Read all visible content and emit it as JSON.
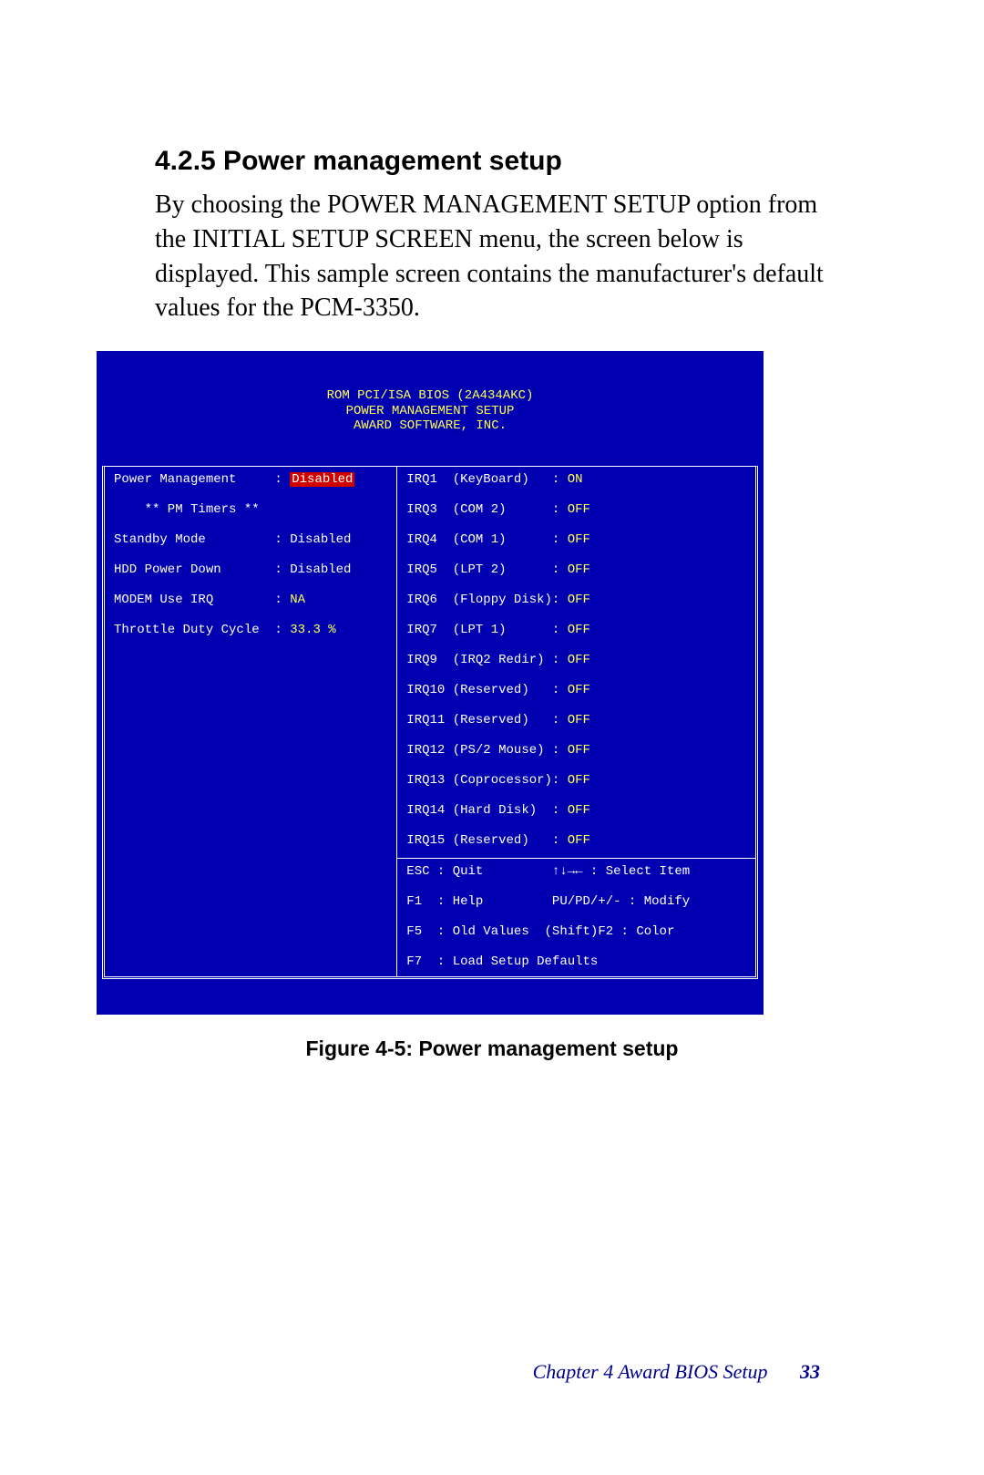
{
  "heading": "4.2.5 Power management setup",
  "body": "By choosing the POWER MANAGEMENT SETUP option from the INITIAL SETUP SCREEN menu, the screen below is displayed. This sample screen contains the manufacturer's default values for the PCM-3350.",
  "bios": {
    "header": {
      "l1": "ROM PCI/ISA BIOS (2A434AKC)",
      "l2": "POWER MANAGEMENT SETUP",
      "l3": "AWARD SOFTWARE, INC."
    },
    "left": {
      "r1_label": "Power Management     : ",
      "r1_value": "Disabled",
      "r2_label": "    ** PM Timers **",
      "r3_label": "Standby Mode         : ",
      "r3_value": "Disabled",
      "r4_label": "HDD Power Down       : ",
      "r4_value": "Disabled",
      "r5_label": "MODEM Use IRQ        : ",
      "r5_value": "NA",
      "r6_label": "Throttle Duty Cycle  : ",
      "r6_value": "33.3 %"
    },
    "right_top": {
      "irq1_l": "IRQ1  (KeyBoard)   : ",
      "irq1_v": "ON",
      "irq3_l": "IRQ3  (COM 2)      : ",
      "irq3_v": "OFF",
      "irq4_l": "IRQ4  (COM 1)      : ",
      "irq4_v": "OFF",
      "irq5_l": "IRQ5  (LPT 2)      : ",
      "irq5_v": "OFF",
      "irq6_l": "IRQ6  (Floppy Disk): ",
      "irq6_v": "OFF",
      "irq7_l": "IRQ7  (LPT 1)      : ",
      "irq7_v": "OFF",
      "irq9_l": "IRQ9  (IRQ2 Redir) : ",
      "irq9_v": "OFF",
      "irq10_l": "IRQ10 (Reserved)   : ",
      "irq10_v": "OFF",
      "irq11_l": "IRQ11 (Reserved)   : ",
      "irq11_v": "OFF",
      "irq12_l": "IRQ12 (PS/2 Mouse) : ",
      "irq12_v": "OFF",
      "irq13_l": "IRQ13 (Coprocessor): ",
      "irq13_v": "OFF",
      "irq14_l": "IRQ14 (Hard Disk)  : ",
      "irq14_v": "OFF",
      "irq15_l": "IRQ15 (Reserved)   : ",
      "irq15_v": "OFF"
    },
    "right_bottom": {
      "l1": "ESC : Quit         ↑↓→← : Select Item",
      "l2": "F1  : Help         PU/PD/+/- : Modify",
      "l3": "F5  : Old Values  (Shift)F2 : Color",
      "l4": "F7  : Load Setup Defaults"
    }
  },
  "caption": "Figure 4-5: Power management setup",
  "footer": {
    "chapter": "Chapter 4  Award BIOS Setup",
    "page": "33"
  }
}
